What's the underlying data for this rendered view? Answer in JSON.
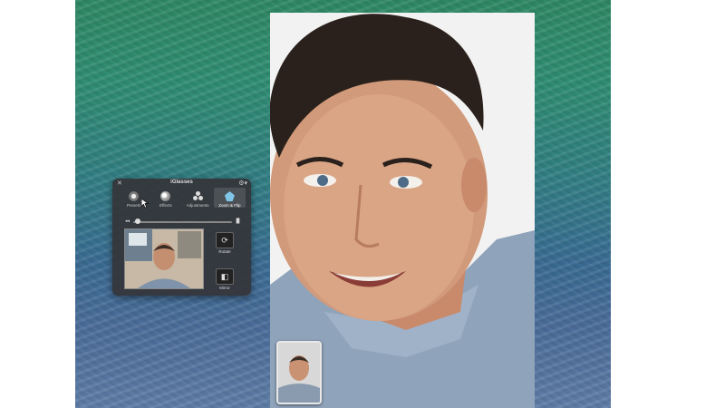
{
  "panel": {
    "title": "iGlasses",
    "close_glyph": "✕",
    "gear_glyph": "⚙▾",
    "tabs": [
      {
        "label": "Presets",
        "icon": "presets-icon",
        "active": false
      },
      {
        "label": "Effects",
        "icon": "effects-icon",
        "active": false
      },
      {
        "label": "Adjustments",
        "icon": "adjustments-icon",
        "active": false
      },
      {
        "label": "Zoom & Flip",
        "icon": "zoom-flip-icon",
        "active": true
      }
    ],
    "slider": {
      "min_glyph": "◂◂",
      "max_glyph": "▐▌",
      "value": 0.02
    },
    "rotate_label": "Rotate",
    "mirror_label": "Mirror"
  },
  "colors": {
    "panel_bg": "#343438",
    "active_tab_icon": "#7fc6e8",
    "desktop_top": "#2f8a66",
    "desktop_bottom": "#5f7ea8"
  }
}
